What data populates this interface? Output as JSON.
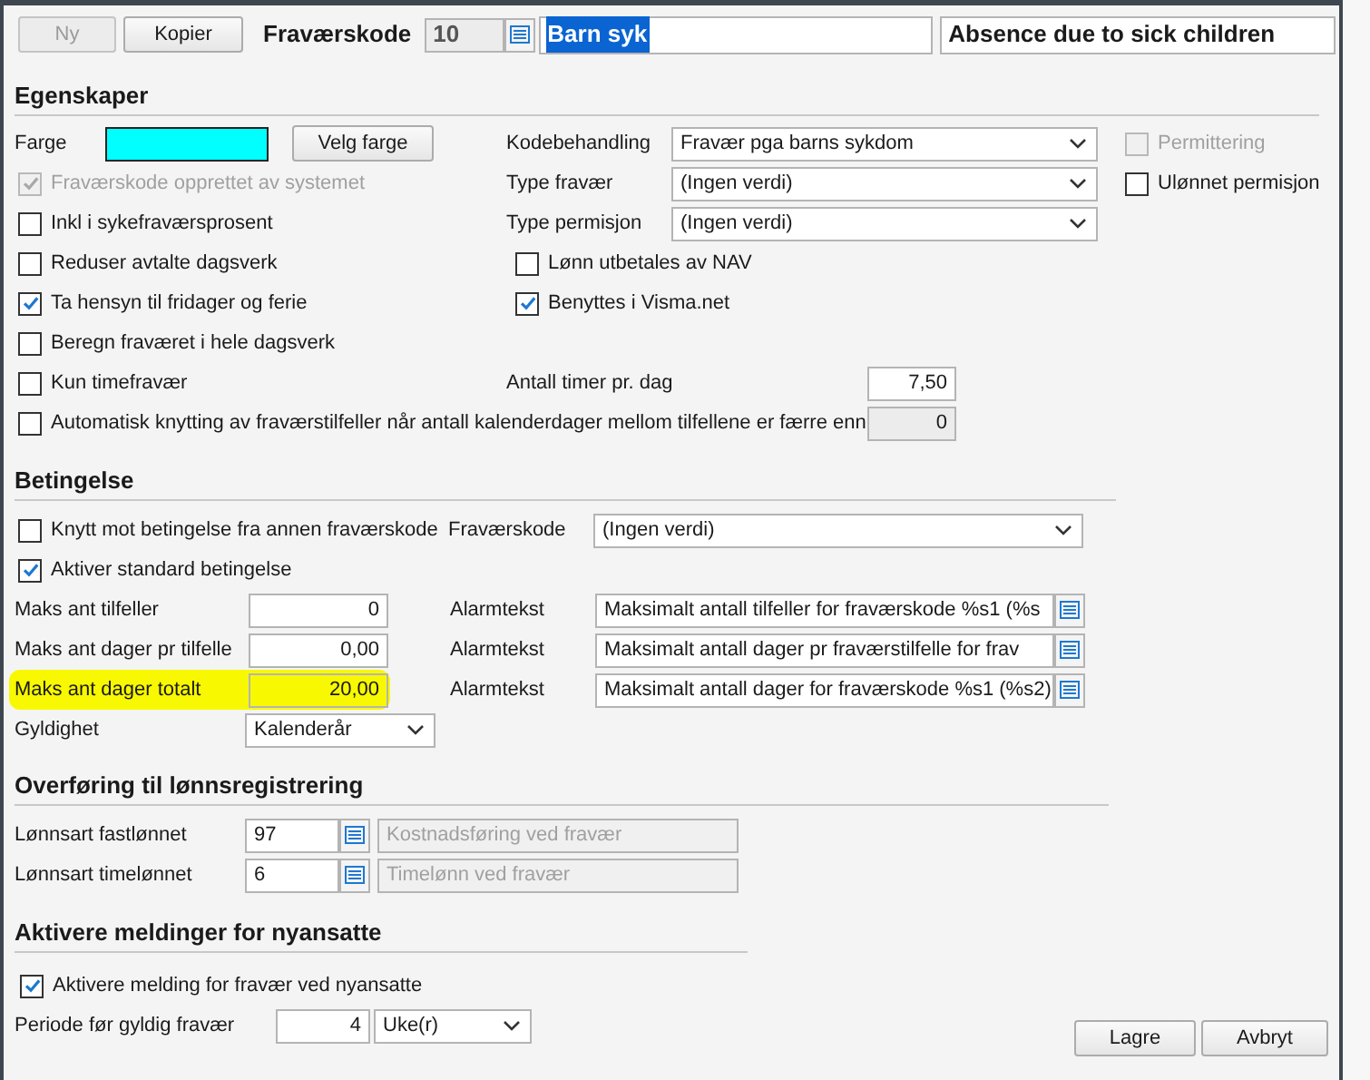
{
  "toolbar": {
    "buttons": [
      {
        "label": "Ny",
        "disabled": true
      },
      {
        "label": "Kopier",
        "disabled": false
      }
    ],
    "code_label": "Fraværskode",
    "code": "10",
    "name": "Barn syk",
    "name_selected": true,
    "english_name": "Absence due to sick children"
  },
  "properties": {
    "title": "Egenskaper",
    "color_label": "Farge",
    "color": "#00ffff",
    "color_button": "Velg farge",
    "checks": [
      {
        "label": "Fraværskode opprettet av systemet",
        "checked": true,
        "disabled": true
      },
      {
        "label": "Inkl i sykefraværsprosent",
        "checked": false,
        "disabled": false
      },
      {
        "label": "Reduser avtalte dagsverk",
        "checked": false,
        "disabled": false
      },
      {
        "label": "Ta hensyn til fridager og ferie",
        "checked": true,
        "disabled": false
      },
      {
        "label": "Beregn fraværet i hele dagsverk",
        "checked": false,
        "disabled": false
      },
      {
        "label": "Kun timefravær",
        "checked": false,
        "disabled": false
      }
    ],
    "selects": [
      {
        "label": "Kodebehandling",
        "value": "Fravær pga barns sykdom"
      },
      {
        "label": "Type fravær",
        "value": "(Ingen verdi)"
      },
      {
        "label": "Type permisjon",
        "value": "(Ingen verdi)"
      }
    ],
    "middle_checks": [
      {
        "label": "Lønn utbetales av NAV",
        "checked": false
      },
      {
        "label": "Benyttes i Visma.net",
        "checked": true
      }
    ],
    "hours": {
      "label": "Antall timer pr. dag",
      "value": "7,50"
    },
    "right_checks": [
      {
        "label": "Permittering",
        "checked": false,
        "disabled": true
      },
      {
        "label": "Ulønnet permisjon",
        "checked": false,
        "disabled": false
      }
    ],
    "auto_link": {
      "label": "Automatisk knytting av fraværstilfeller når antall kalenderdager mellom tilfellene er færre enn",
      "checked": false,
      "value": "0"
    }
  },
  "conditions": {
    "title": "Betingelse",
    "link": {
      "label": "Knytt mot betingelse fra annen fraværskode",
      "checked": false,
      "code_label": "Fraværskode",
      "code_value": "(Ingen verdi)"
    },
    "standard": {
      "label": "Aktiver standard betingelse",
      "checked": true
    },
    "limits": [
      {
        "label": "Maks ant tilfeller",
        "value": "0",
        "alarm_label": "Alarmtekst",
        "alarm": "Maksimalt antall tilfeller for fraværskode %s1 (%s",
        "highlighted": false
      },
      {
        "label": "Maks ant dager pr tilfelle",
        "value": "0,00",
        "alarm_label": "Alarmtekst",
        "alarm": "Maksimalt antall dager pr fraværstilfelle for frav",
        "highlighted": false
      },
      {
        "label": "Maks ant dager totalt",
        "value": "20,00",
        "alarm_label": "Alarmtekst",
        "alarm": "Maksimalt antall dager for fraværskode %s1 (%s2)",
        "highlighted": true
      }
    ],
    "validity": {
      "label": "Gyldighet",
      "value": "Kalenderår"
    }
  },
  "transfer": {
    "title": "Overføring til lønnsregistrering",
    "rows": [
      {
        "label": "Lønnsart fastlønnet",
        "code": "97",
        "description": "Kostnadsføring ved fravær"
      },
      {
        "label": "Lønnsart timelønnet",
        "code": "6",
        "description": "Timelønn ved fravær"
      }
    ]
  },
  "new_hires": {
    "title": "Aktivere meldinger for nyansatte",
    "check": {
      "label": "Aktivere melding for fravær ved nyansatte",
      "checked": true
    },
    "period": {
      "label": "Periode før gyldig fravær",
      "value": "4",
      "unit": "Uke(r)"
    }
  },
  "buttons": [
    "Lagre",
    "Avbryt"
  ]
}
